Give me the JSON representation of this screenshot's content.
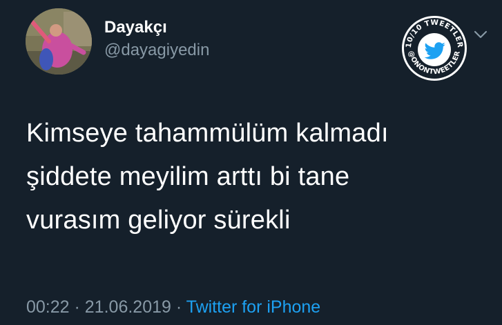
{
  "user": {
    "display_name": "Dayakçı",
    "handle": "@dayagiyedin"
  },
  "badge": {
    "top_text": "10/10 TWEETLER",
    "bottom_text": "@ONONTWEETLER",
    "icon": "twitter-bird-icon",
    "color": "#1da1f2"
  },
  "tweet": {
    "lines": [
      "Kimseye tahammülüm kalmadı",
      "şiddete meyilim arttı bi tane",
      "vurasım geliyor sürekli"
    ]
  },
  "meta": {
    "time": "00:22",
    "separator": " · ",
    "date": "21.06.2019",
    "source": "Twitter for iPhone"
  },
  "colors": {
    "background": "#15202b",
    "secondary_text": "#8899a6",
    "link": "#1da1f2"
  }
}
